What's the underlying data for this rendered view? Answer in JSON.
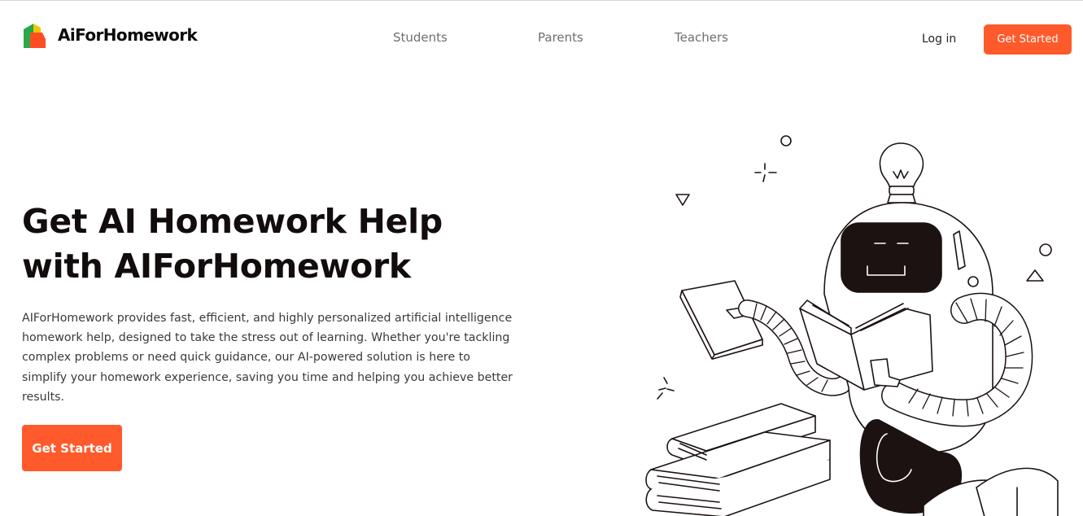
{
  "header": {
    "brand": "AiForHomework",
    "nav": [
      {
        "label": "Students"
      },
      {
        "label": "Parents"
      },
      {
        "label": "Teachers"
      }
    ],
    "login_label": "Log in",
    "cta_label": "Get Started"
  },
  "hero": {
    "title_line1": "Get AI Homework Help",
    "title_line2": "with AIForHomework",
    "description": "AIForHomework provides fast, efficient, and highly personalized artificial intelligence homework help, designed to take the stress out of learning. Whether you're tackling complex problems or need quick guidance, our AI-powered solution is here to simplify your homework experience, saving you time and helping you achieve better results.",
    "cta_label": "Get Started"
  },
  "colors": {
    "accent": "#ff5a2b",
    "text_dark": "#120c0c",
    "nav_text": "#6f6f6f"
  },
  "icons": {
    "logo": "stacked-books-logo-icon",
    "illustration": "robot-reading-books-illustration"
  }
}
